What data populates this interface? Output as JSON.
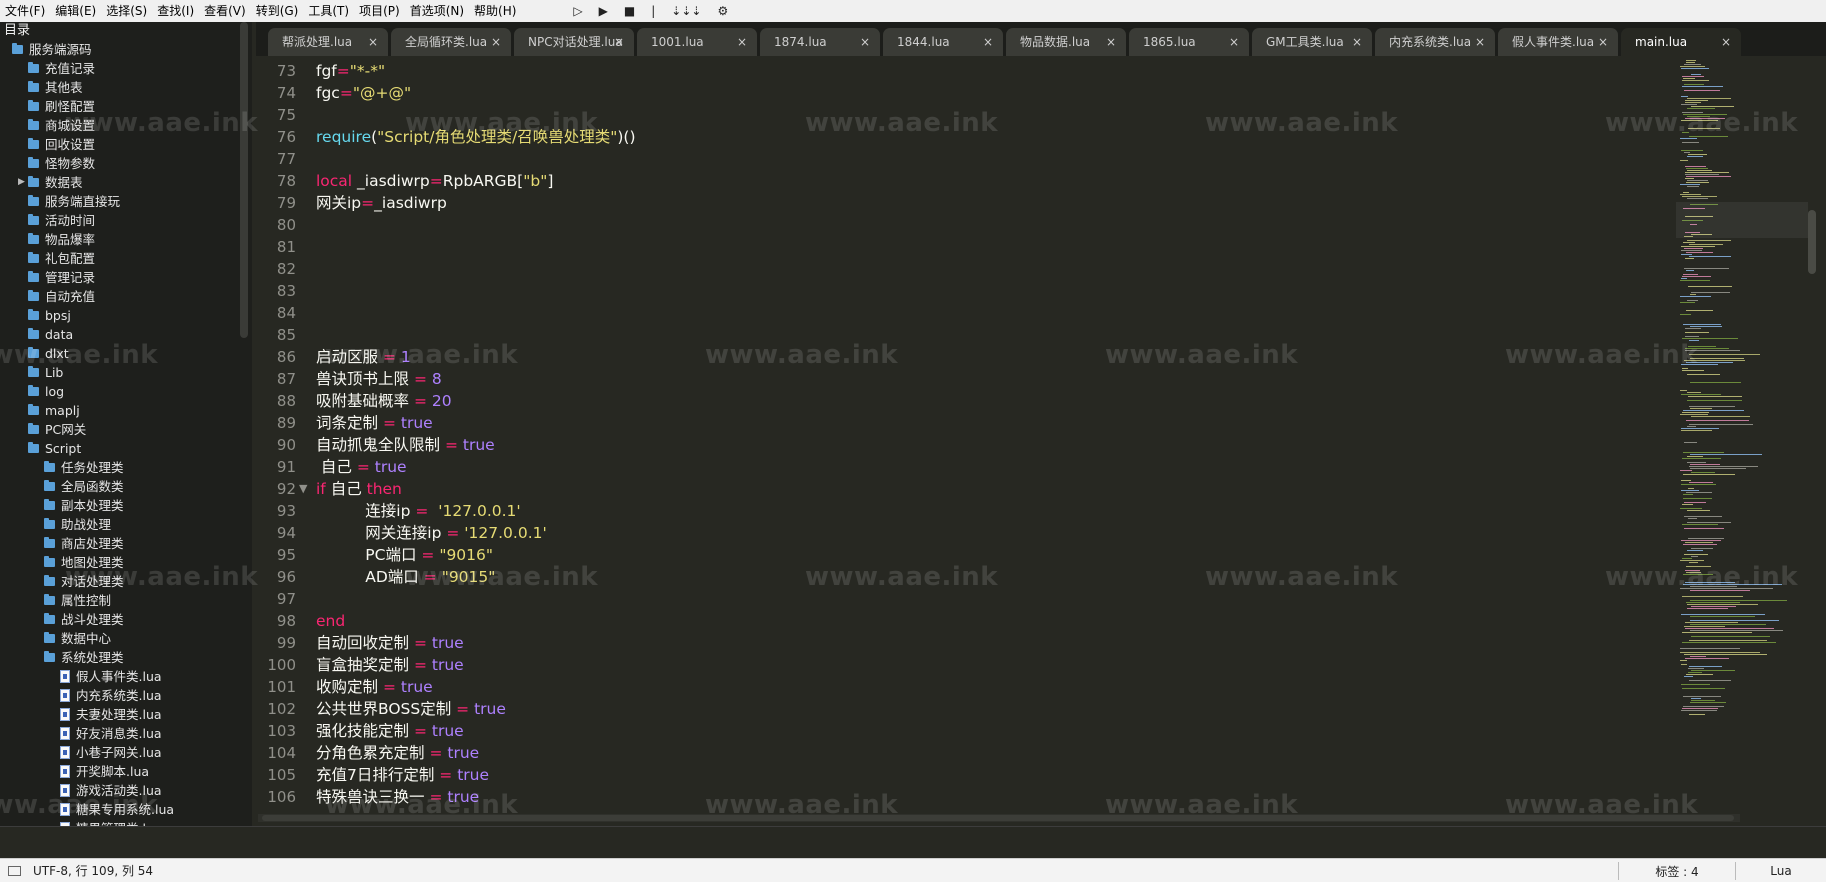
{
  "menu": {
    "items": [
      "文件(F)",
      "编辑(E)",
      "选择(S)",
      "查找(I)",
      "查看(V)",
      "转到(G)",
      "工具(T)",
      "项目(P)",
      "首选项(N)",
      "帮助(H)"
    ],
    "toolbar_icons": [
      "run-outline-icon",
      "run-icon",
      "stop-icon",
      "separator-icon",
      "step-icon",
      "settings-icon"
    ],
    "toolbar_glyphs": [
      "▷",
      "▶",
      "■",
      "|",
      "⇣⇣⇣",
      "⚙"
    ]
  },
  "sidebar": {
    "title": "目录",
    "items": [
      {
        "label": "服务端源码",
        "type": "folder",
        "level": 0,
        "expanded": true
      },
      {
        "label": "充值记录",
        "type": "folder",
        "level": 1
      },
      {
        "label": "其他表",
        "type": "folder",
        "level": 1
      },
      {
        "label": "刷怪配置",
        "type": "folder",
        "level": 1
      },
      {
        "label": "商城设置",
        "type": "folder",
        "level": 1
      },
      {
        "label": "回收设置",
        "type": "folder",
        "level": 1
      },
      {
        "label": "怪物参数",
        "type": "folder",
        "level": 1
      },
      {
        "label": "数据表",
        "type": "folder",
        "level": 1,
        "collapsed": true
      },
      {
        "label": "服务端直接玩",
        "type": "folder",
        "level": 1
      },
      {
        "label": "活动时间",
        "type": "folder",
        "level": 1
      },
      {
        "label": "物品爆率",
        "type": "folder",
        "level": 1
      },
      {
        "label": "礼包配置",
        "type": "folder",
        "level": 1
      },
      {
        "label": "管理记录",
        "type": "folder",
        "level": 1
      },
      {
        "label": "自动充值",
        "type": "folder",
        "level": 1
      },
      {
        "label": "bpsj",
        "type": "folder",
        "level": 1
      },
      {
        "label": "data",
        "type": "folder",
        "level": 1
      },
      {
        "label": "dlxt",
        "type": "folder",
        "level": 1
      },
      {
        "label": "Lib",
        "type": "folder",
        "level": 1
      },
      {
        "label": "log",
        "type": "folder",
        "level": 1
      },
      {
        "label": "maplj",
        "type": "folder",
        "level": 1
      },
      {
        "label": "PC网关",
        "type": "folder",
        "level": 1
      },
      {
        "label": "Script",
        "type": "folder",
        "level": 1,
        "expanded": true
      },
      {
        "label": "任务处理类",
        "type": "folder",
        "level": 2
      },
      {
        "label": "全局函数类",
        "type": "folder",
        "level": 2
      },
      {
        "label": "副本处理类",
        "type": "folder",
        "level": 2
      },
      {
        "label": "助战处理",
        "type": "folder",
        "level": 2
      },
      {
        "label": "商店处理类",
        "type": "folder",
        "level": 2
      },
      {
        "label": "地图处理类",
        "type": "folder",
        "level": 2
      },
      {
        "label": "对话处理类",
        "type": "folder",
        "level": 2
      },
      {
        "label": "属性控制",
        "type": "folder",
        "level": 2
      },
      {
        "label": "战斗处理类",
        "type": "folder",
        "level": 2
      },
      {
        "label": "数据中心",
        "type": "folder",
        "level": 2
      },
      {
        "label": "系统处理类",
        "type": "folder",
        "level": 2,
        "expanded": true
      },
      {
        "label": "假人事件类.lua",
        "type": "file",
        "level": 3
      },
      {
        "label": "内充系统类.lua",
        "type": "file",
        "level": 3
      },
      {
        "label": "夫妻处理类.lua",
        "type": "file",
        "level": 3
      },
      {
        "label": "好友消息类.lua",
        "type": "file",
        "level": 3
      },
      {
        "label": "小巷子网关.lua",
        "type": "file",
        "level": 3
      },
      {
        "label": "开奖脚本.lua",
        "type": "file",
        "level": 3
      },
      {
        "label": "游戏活动类.lua",
        "type": "file",
        "level": 3
      },
      {
        "label": "糖果专用系统.lua",
        "type": "file",
        "level": 3
      },
      {
        "label": "糖果管理类.lua",
        "type": "file",
        "level": 3
      }
    ]
  },
  "tabs": [
    {
      "label": "帮派处理.lua",
      "active": false
    },
    {
      "label": "全局循环类.lua",
      "active": false
    },
    {
      "label": "NPC对话处理.lua",
      "active": false
    },
    {
      "label": "1001.lua",
      "active": false
    },
    {
      "label": "1874.lua",
      "active": false
    },
    {
      "label": "1844.lua",
      "active": false
    },
    {
      "label": "物品数据.lua",
      "active": false
    },
    {
      "label": "1865.lua",
      "active": false
    },
    {
      "label": "GM工具类.lua",
      "active": false
    },
    {
      "label": "内充系统类.lua",
      "active": false
    },
    {
      "label": "假人事件类.lua",
      "active": false
    },
    {
      "label": "main.lua",
      "active": true
    }
  ],
  "tab_close_glyph": "×",
  "editor": {
    "lines": [
      {
        "num": "73",
        "tokens": [
          [
            "v",
            "fgf"
          ],
          [
            "o",
            "="
          ],
          [
            "s",
            "\"*-*\""
          ]
        ]
      },
      {
        "num": "74",
        "tokens": [
          [
            "v",
            "fgc"
          ],
          [
            "o",
            "="
          ],
          [
            "s",
            "\"@+@\""
          ]
        ]
      },
      {
        "num": "75",
        "tokens": []
      },
      {
        "num": "76",
        "tokens": [
          [
            "f",
            "require"
          ],
          [
            "v",
            "("
          ],
          [
            "s",
            "\"Script/角色处理类/召唤兽处理类\""
          ],
          [
            "v",
            ")()"
          ]
        ]
      },
      {
        "num": "77",
        "tokens": []
      },
      {
        "num": "78",
        "tokens": [
          [
            "k",
            "local"
          ],
          [
            "v",
            " _iasdiwrp"
          ],
          [
            "o",
            "="
          ],
          [
            "v",
            "RpbARGB["
          ],
          [
            "s",
            "\"b\""
          ],
          [
            "v",
            "]"
          ]
        ]
      },
      {
        "num": "79",
        "tokens": [
          [
            "v",
            "网关ip"
          ],
          [
            "o",
            "="
          ],
          [
            "v",
            "_iasdiwrp"
          ]
        ]
      },
      {
        "num": "80",
        "tokens": []
      },
      {
        "num": "81",
        "tokens": []
      },
      {
        "num": "82",
        "tokens": []
      },
      {
        "num": "83",
        "tokens": []
      },
      {
        "num": "84",
        "tokens": []
      },
      {
        "num": "85",
        "tokens": []
      },
      {
        "num": "86",
        "tokens": [
          [
            "v",
            "启动区服 "
          ],
          [
            "o",
            "="
          ],
          [
            "n",
            " 1"
          ]
        ]
      },
      {
        "num": "87",
        "tokens": [
          [
            "v",
            "兽诀顶书上限 "
          ],
          [
            "o",
            "="
          ],
          [
            "n",
            " 8"
          ]
        ]
      },
      {
        "num": "88",
        "tokens": [
          [
            "v",
            "吸附基础概率 "
          ],
          [
            "o",
            "="
          ],
          [
            "n",
            " 20"
          ]
        ]
      },
      {
        "num": "89",
        "tokens": [
          [
            "v",
            "词条定制 "
          ],
          [
            "o",
            "="
          ],
          [
            "n",
            " true"
          ]
        ]
      },
      {
        "num": "90",
        "tokens": [
          [
            "v",
            "自动抓鬼全队限制 "
          ],
          [
            "o",
            "="
          ],
          [
            "n",
            " true"
          ]
        ]
      },
      {
        "num": "91",
        "tokens": [
          [
            "v",
            " 自己 "
          ],
          [
            "o",
            "="
          ],
          [
            "n",
            " true"
          ]
        ]
      },
      {
        "num": "92",
        "fold": true,
        "tokens": [
          [
            "k",
            "if"
          ],
          [
            "v",
            " 自己 "
          ],
          [
            "k",
            "then"
          ]
        ]
      },
      {
        "num": "93",
        "tokens": [
          [
            "v",
            "          连接ip "
          ],
          [
            "o",
            "="
          ],
          [
            "v",
            "  "
          ],
          [
            "s",
            "'127.0.0.1'"
          ]
        ]
      },
      {
        "num": "94",
        "tokens": [
          [
            "v",
            "          网关连接ip "
          ],
          [
            "o",
            "="
          ],
          [
            "v",
            " "
          ],
          [
            "s",
            "'127.0.0.1'"
          ]
        ]
      },
      {
        "num": "95",
        "tokens": [
          [
            "v",
            "          PC端口 "
          ],
          [
            "o",
            "="
          ],
          [
            "v",
            " "
          ],
          [
            "s",
            "\"9016\""
          ]
        ]
      },
      {
        "num": "96",
        "tokens": [
          [
            "v",
            "          AD端口 "
          ],
          [
            "o",
            "="
          ],
          [
            "v",
            " "
          ],
          [
            "s",
            "\"9015\""
          ]
        ]
      },
      {
        "num": "97",
        "tokens": []
      },
      {
        "num": "98",
        "tokens": [
          [
            "k",
            "end"
          ]
        ]
      },
      {
        "num": "99",
        "tokens": [
          [
            "v",
            "自动回收定制 "
          ],
          [
            "o",
            "="
          ],
          [
            "n",
            " true"
          ]
        ]
      },
      {
        "num": "100",
        "tokens": [
          [
            "v",
            "盲盒抽奖定制 "
          ],
          [
            "o",
            "="
          ],
          [
            "n",
            " true"
          ]
        ]
      },
      {
        "num": "101",
        "tokens": [
          [
            "v",
            "收购定制 "
          ],
          [
            "o",
            "="
          ],
          [
            "n",
            " true"
          ]
        ]
      },
      {
        "num": "102",
        "tokens": [
          [
            "v",
            "公共世界BOSS定制 "
          ],
          [
            "o",
            "="
          ],
          [
            "n",
            " true"
          ]
        ]
      },
      {
        "num": "103",
        "tokens": [
          [
            "v",
            "强化技能定制 "
          ],
          [
            "o",
            "="
          ],
          [
            "n",
            " true"
          ]
        ]
      },
      {
        "num": "104",
        "tokens": [
          [
            "v",
            "分角色累充定制 "
          ],
          [
            "o",
            "="
          ],
          [
            "n",
            " true"
          ]
        ]
      },
      {
        "num": "105",
        "tokens": [
          [
            "v",
            "充值7日排行定制 "
          ],
          [
            "o",
            "="
          ],
          [
            "n",
            " true"
          ]
        ]
      },
      {
        "num": "106",
        "tokens": [
          [
            "v",
            "特殊兽诀三换一 "
          ],
          [
            "o",
            "="
          ],
          [
            "n",
            " true"
          ]
        ]
      }
    ],
    "fold_glyph": "▼"
  },
  "watermark_text": "www.aae.ink",
  "status": {
    "encoding_position": "UTF-8, 行 109, 列 54",
    "indent": "标签 : 4",
    "language": "Lua"
  },
  "colors": {
    "keyword": "#f92672",
    "string": "#e6db74",
    "number": "#ae81ff",
    "function": "#66d9ef",
    "background": "#272822"
  }
}
